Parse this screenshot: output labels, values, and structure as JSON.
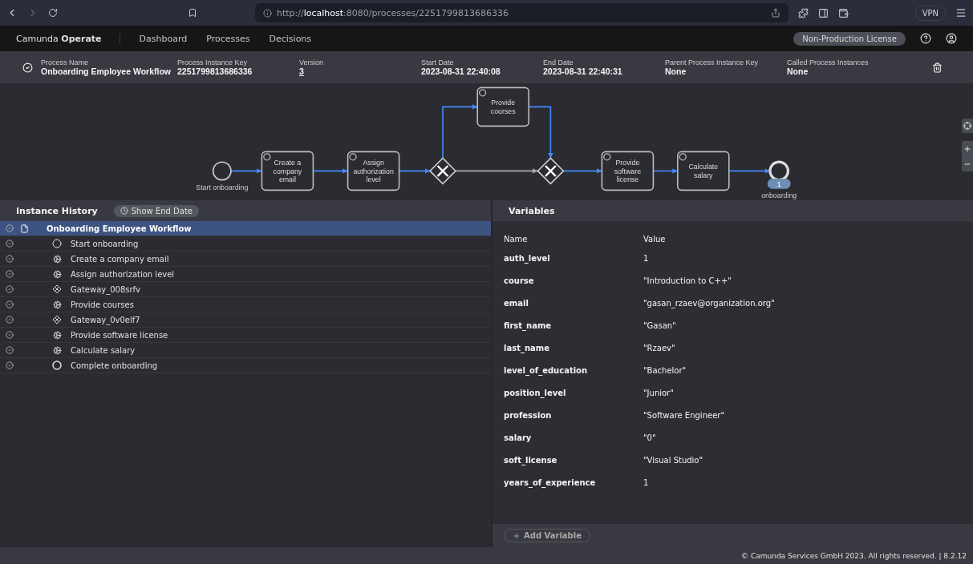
{
  "browser": {
    "url": "http://**localhost**:8080/processes/2251799813686336",
    "vpn": "VPN"
  },
  "header": {
    "brand": "Camunda",
    "product": "Operate",
    "nav": [
      {
        "label": "Dashboard",
        "selected": false
      },
      {
        "label": "Processes",
        "selected": false
      },
      {
        "label": "Decisions",
        "selected": false
      }
    ],
    "license": "Non-Production License"
  },
  "summary": {
    "fields": [
      {
        "label": "Process Name",
        "value": "Onboarding Employee Workflow",
        "kind": "text"
      },
      {
        "label": "Process Instance Key",
        "value": "2251799813686336",
        "kind": "text"
      },
      {
        "label": "Version",
        "value": "3",
        "kind": "link"
      },
      {
        "label": "Start Date",
        "value": "2023-08-31 22:40:08",
        "kind": "text"
      },
      {
        "label": "End Date",
        "value": "2023-08-31 22:40:31",
        "kind": "text"
      },
      {
        "label": "Parent Process Instance Key",
        "value": "None",
        "kind": "text"
      },
      {
        "label": "Called Process Instances",
        "value": "None",
        "kind": "text"
      }
    ]
  },
  "diagram": {
    "nodes": [
      {
        "kind": "start",
        "label": "Start onboarding"
      },
      {
        "kind": "task",
        "label": "Create a company email"
      },
      {
        "kind": "task",
        "label": "Assign authorization level"
      },
      {
        "kind": "gateway"
      },
      {
        "kind": "task",
        "label": "Provide courses"
      },
      {
        "kind": "gateway"
      },
      {
        "kind": "task",
        "label": "Provide software license"
      },
      {
        "kind": "task",
        "label": "Calculate salary"
      },
      {
        "kind": "end",
        "label": "onboarding"
      }
    ],
    "badge": "1"
  },
  "history": {
    "title": "Instance History",
    "toggle": "Show End Date",
    "root": {
      "label": "Onboarding Employee Workflow",
      "selected": true,
      "children": [
        {
          "label": "Start onboarding",
          "kind": "event",
          "selected": false
        },
        {
          "label": "Create a company email",
          "kind": "task",
          "selected": false
        },
        {
          "label": "Assign authorization level",
          "kind": "task",
          "selected": false
        },
        {
          "label": "Gateway_008srfv",
          "kind": "gateway",
          "selected": false
        },
        {
          "label": "Provide courses",
          "kind": "task",
          "selected": false
        },
        {
          "label": "Gateway_0v0elf7",
          "kind": "gateway",
          "selected": false
        },
        {
          "label": "Provide software license",
          "kind": "task",
          "selected": false
        },
        {
          "label": "Calculate salary",
          "kind": "task",
          "selected": false
        },
        {
          "label": "Complete onboarding",
          "kind": "end",
          "selected": false
        }
      ]
    }
  },
  "variables": {
    "title": "Variables",
    "columns": [
      "Name",
      "Value"
    ],
    "rows": [
      {
        "name": "auth_level",
        "value": "1"
      },
      {
        "name": "course",
        "value": "\"Introduction to C++\""
      },
      {
        "name": "email",
        "value": "\"gasan_rzaev@organization.org\""
      },
      {
        "name": "first_name",
        "value": "\"Gasan\""
      },
      {
        "name": "last_name",
        "value": "\"Rzaev\""
      },
      {
        "name": "level_of_education",
        "value": "\"Bachelor\""
      },
      {
        "name": "position_level",
        "value": "\"Junior\""
      },
      {
        "name": "profession",
        "value": "\"Software Engineer\""
      },
      {
        "name": "salary",
        "value": "\"0\""
      },
      {
        "name": "soft_license",
        "value": "\"Visual Studio\""
      },
      {
        "name": "years_of_experience",
        "value": "1"
      }
    ],
    "add": "Add Variable"
  },
  "footer": "© Camunda Services GmbH 2023. All rights reserved. | 8.2.12"
}
